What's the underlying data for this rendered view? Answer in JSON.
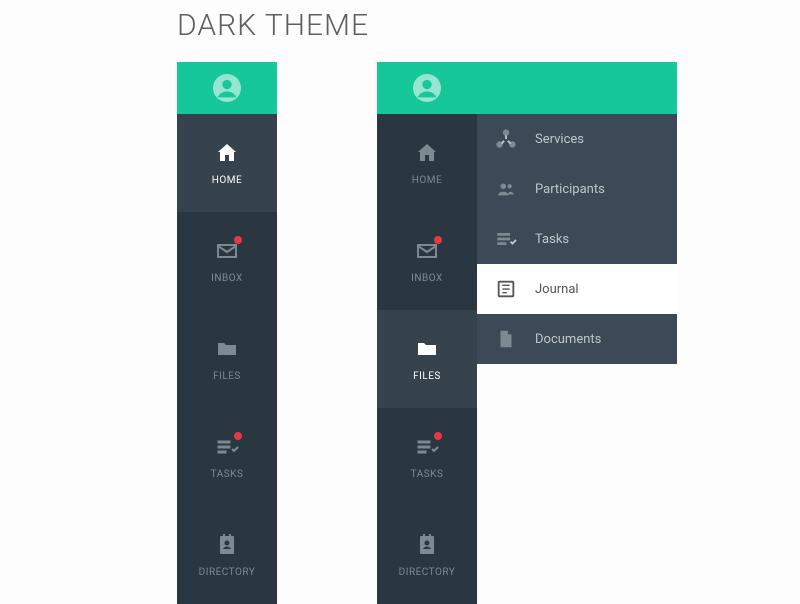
{
  "title": "DARK THEME",
  "colors": {
    "accent": "#16c79a",
    "rail_bg": "#2b3740",
    "rail_selected": "#36424c",
    "submenu_bg": "#3b4a56",
    "badge": "#e53946"
  },
  "rail1": {
    "selected_index": 0,
    "items": [
      {
        "label": "HOME",
        "icon": "home-icon",
        "badge": false
      },
      {
        "label": "INBOX",
        "icon": "mail-icon",
        "badge": true
      },
      {
        "label": "FILES",
        "icon": "folder-icon",
        "badge": false
      },
      {
        "label": "TASKS",
        "icon": "tasks-icon",
        "badge": true
      },
      {
        "label": "DIRECTORY",
        "icon": "contacts-icon",
        "badge": false
      }
    ]
  },
  "rail2": {
    "expanded_index": 2,
    "items": [
      {
        "label": "HOME",
        "icon": "home-icon",
        "badge": false
      },
      {
        "label": "INBOX",
        "icon": "mail-icon",
        "badge": true
      },
      {
        "label": "FILES",
        "icon": "folder-icon",
        "badge": false
      },
      {
        "label": "TASKS",
        "icon": "tasks-icon",
        "badge": true
      },
      {
        "label": "DIRECTORY",
        "icon": "contacts-icon",
        "badge": false
      }
    ]
  },
  "submenu": {
    "active_index": 3,
    "items": [
      {
        "label": "Services",
        "icon": "hub-icon"
      },
      {
        "label": "Participants",
        "icon": "people-icon"
      },
      {
        "label": "Tasks",
        "icon": "list-check-icon"
      },
      {
        "label": "Journal",
        "icon": "journal-icon"
      },
      {
        "label": "Documents",
        "icon": "document-icon"
      }
    ]
  }
}
